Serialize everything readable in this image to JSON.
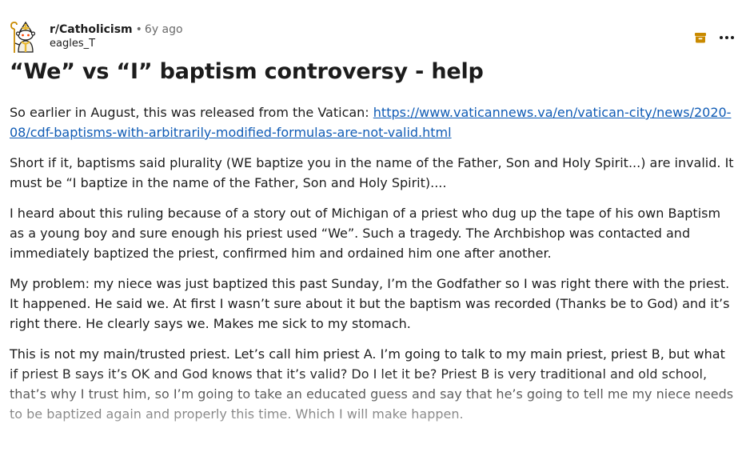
{
  "post": {
    "subreddit": "r/Catholicism",
    "separator": "•",
    "age": "6y ago",
    "author": "eagles_T",
    "avatar_icon": "pope-snoo-avatar-icon",
    "archive_icon": "archive-box-icon",
    "more_icon": "more-options-icon",
    "title": "“We” vs “I” baptism controversy - help",
    "paragraphs": {
      "p1_text": "So earlier in August, this was released from the Vatican: ",
      "p1_link": "https://www.vaticannews.va/en/vatican-city/news/2020-08/cdf-baptisms-with-arbitrarily-modified-formulas-are-not-valid.html",
      "p2": "Short if it, baptisms said plurality (WE baptize you in the name of the Father, Son and Holy Spirit...) are invalid. It must be “I baptize in the name of the Father, Son and Holy Spirit)....",
      "p3": "I heard about this ruling because of a story out of Michigan of a priest who dug up the tape of his own Baptism as a young boy and sure enough his priest used “We”. Such a tragedy. The Archbishop was contacted and immediately baptized the priest, confirmed him and ordained him one after another.",
      "p4": "My problem: my niece was just baptized this past Sunday, I’m the Godfather so I was right there with the priest. It happened. He said we. At first I wasn’t sure about it but the baptism was recorded (Thanks be to God) and it’s right there. He clearly says we. Makes me sick to my stomach.",
      "p5": "This is not my main/trusted priest. Let’s call him priest A. I’m going to talk to my main priest, priest B, but what if priest B says it’s OK and God knows that it’s valid? Do I let it be? Priest B is very traditional and old school, that’s why I trust him, so I’m going to take an educated guess and say that he’s going to tell me my niece needs to be baptized again and properly this time. Which I will make happen."
    }
  },
  "colors": {
    "link": "#0f5bb5",
    "archive_icon": "#c98a00",
    "meta_grey": "#6b6b6b"
  }
}
